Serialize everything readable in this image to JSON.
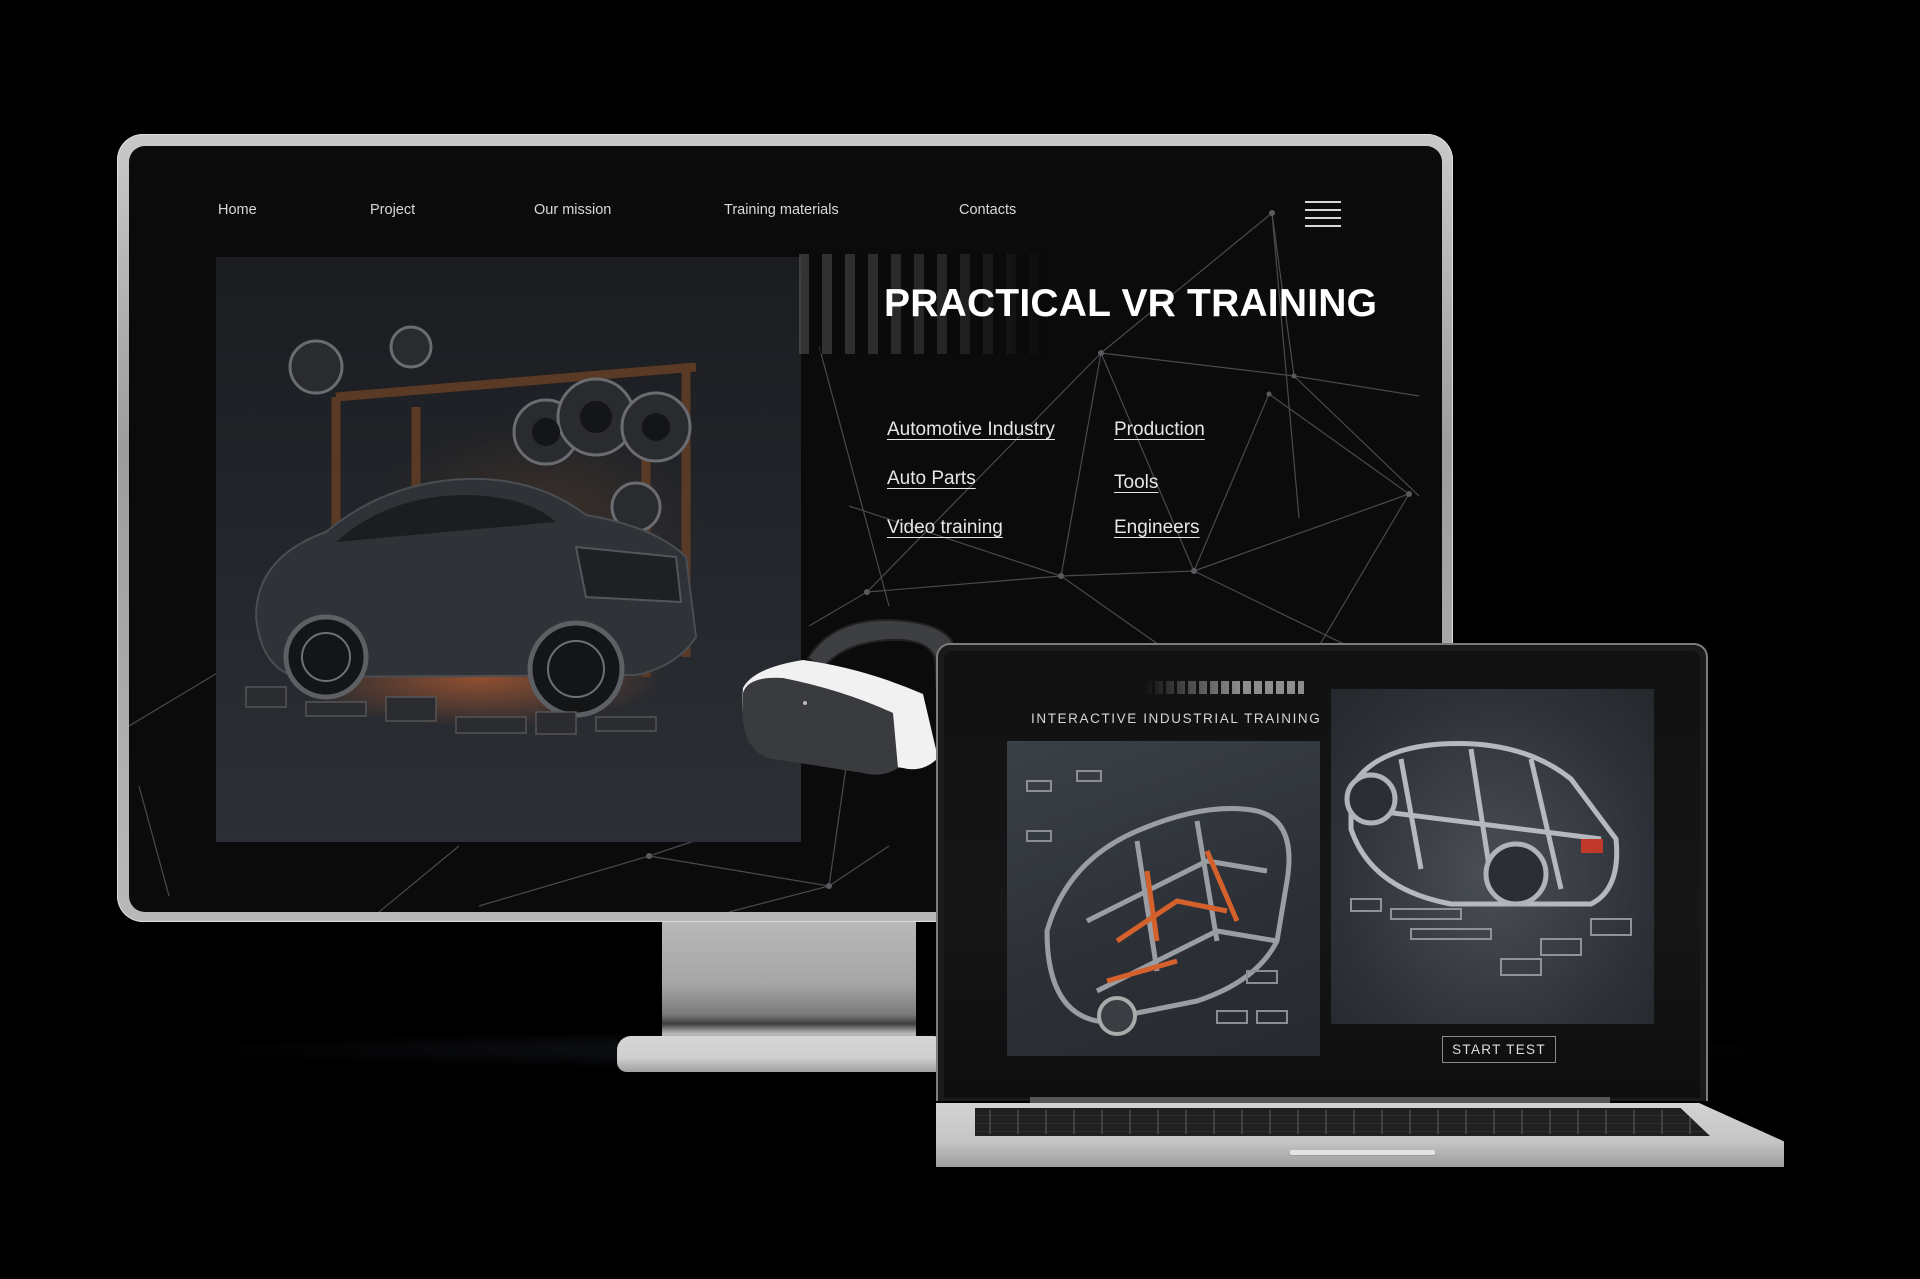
{
  "monitor": {
    "nav": {
      "items": [
        {
          "label": "Home"
        },
        {
          "label": "Project"
        },
        {
          "label": "Our mission"
        },
        {
          "label": "Training materials"
        },
        {
          "label": "Contacts"
        }
      ],
      "menu_icon": "hamburger-menu-icon"
    },
    "hero": {
      "title": "PRACTICAL VR TRAINING",
      "image": "car-assembly-robot-image",
      "links_col1": [
        {
          "label": "Automotive Industry"
        },
        {
          "label": "Auto Parts"
        },
        {
          "label": "Video training"
        }
      ],
      "links_col2": [
        {
          "label": "Production"
        },
        {
          "label": "Tools"
        },
        {
          "label": "Engineers"
        }
      ]
    },
    "decoration": "vr-headset-image"
  },
  "laptop": {
    "heading": "INTERACTIVE INDUSTRIAL TRAINING",
    "images": [
      "car-frame-exploded-image",
      "car-chassis-image"
    ],
    "button_label": "START TEST"
  },
  "colors": {
    "background": "#000000",
    "screen_bg": "#0b0b0c",
    "accent_orange": "#e06a32",
    "text": "#e6e6e6"
  }
}
